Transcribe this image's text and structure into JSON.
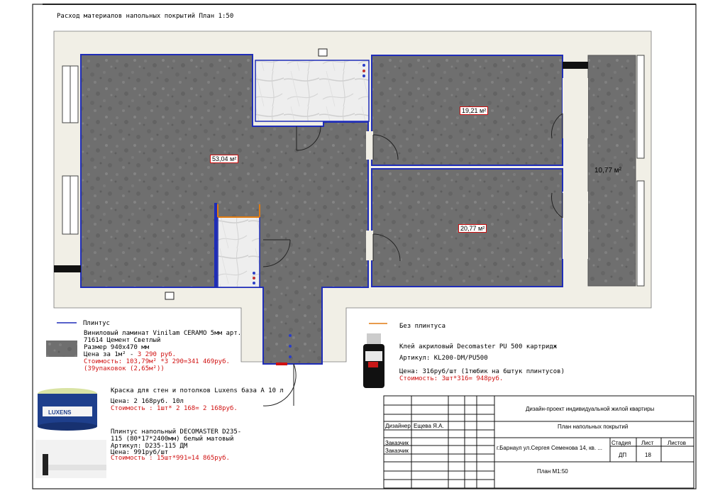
{
  "sheet": {
    "title": "Расход материалов напольных покрытий План 1:50"
  },
  "rooms": {
    "main_area": "53,04 м²",
    "bedroom_top_area": "19,21 м²",
    "bedroom_bottom_area": "20,77 м²",
    "balcony_area": "10,77 м²"
  },
  "legend": {
    "plinth_label": "Плинтус",
    "no_plinth_label": "Без плинтуса",
    "plinth_color": "#1f2db8",
    "no_plinth_color": "#e07a10"
  },
  "materials": {
    "laminate": {
      "name_line1": "Виниловый ламинат Vinilam CERAMO 5мм арт.",
      "name_line2": "71614 Цемент Светлый",
      "size": "Размер 940х470 мм",
      "price_prefix": "Цена за 1м² - ",
      "price_value": "3 290 руб.",
      "cost_line1": "Стоимость: 103,79м² *3 290=341 469руб.",
      "cost_line2": "(39упаковок (2,65м²))"
    },
    "glue": {
      "name": "Клей акриловый Decomaster PU 500 картридж",
      "article": "Артикул: KL200-DM/PU500",
      "price": "Цена: 316руб/шт (1тюбик на 6штук плинтусов)",
      "cost": "Стоимость: 3шт*316= 948руб."
    },
    "paint": {
      "name": "Краска для стен и потолков Luxens база А 10 л",
      "price": "Цена: 2 168руб. 10л",
      "cost": "Стоимость : 1шт* 2 168= 2 168руб.",
      "brand": "LUXENS"
    },
    "plinth": {
      "name_line1": "Плинтус напольный DECOMASTER D235-",
      "name_line2": "115 (80*17*2400мм) белый матовый",
      "article": "Артикул: D235-115 ДМ",
      "price": "Цена: 991руб/шт",
      "cost": "Стоимость : 15шт*991=14 865руб."
    }
  },
  "title_block": {
    "project": "Дизайн-проект индивидуальной жилой квартиры",
    "sheet_name": "План напольных покрытий",
    "designer_label": "Дизайнер",
    "designer_name": "Ещева Я.А.",
    "customer_label_1": "Заказчик",
    "customer_label_2": "Заказчик",
    "address": "г.Барнаул ул.Сергея Семенова 14, кв. ...",
    "stage_label": "Стадия",
    "sheet_label": "Лист",
    "sheets_label": "Листов",
    "stage_value": "ДП",
    "sheet_value": "18",
    "sheets_value": "",
    "scale": "План М1:50"
  }
}
